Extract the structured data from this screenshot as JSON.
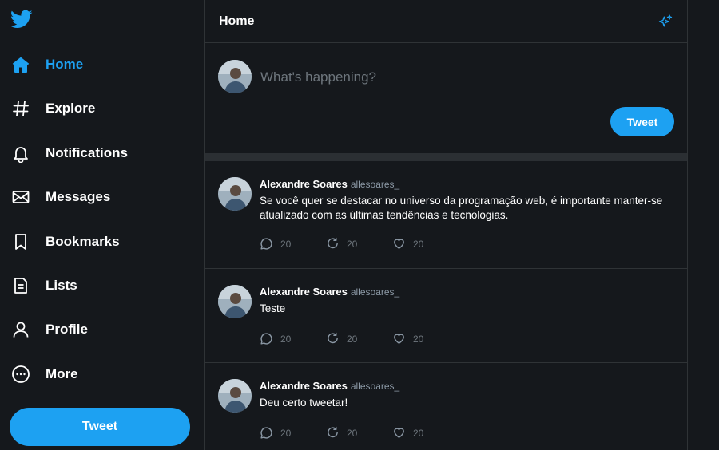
{
  "colors": {
    "accent": "#1da1f2",
    "background": "#15181c",
    "border": "#2f3336",
    "muted": "#6e767d"
  },
  "sidebar": {
    "logo_icon": "twitter-bird-icon",
    "items": [
      {
        "label": "Home",
        "icon": "home-icon",
        "active": true
      },
      {
        "label": "Explore",
        "icon": "hashtag-icon",
        "active": false
      },
      {
        "label": "Notifications",
        "icon": "bell-icon",
        "active": false
      },
      {
        "label": "Messages",
        "icon": "envelope-icon",
        "active": false
      },
      {
        "label": "Bookmarks",
        "icon": "bookmark-icon",
        "active": false
      },
      {
        "label": "Lists",
        "icon": "list-icon",
        "active": false
      },
      {
        "label": "Profile",
        "icon": "user-icon",
        "active": false
      },
      {
        "label": "More",
        "icon": "more-icon",
        "active": false
      }
    ],
    "tweet_button": "Tweet"
  },
  "main": {
    "title": "Home",
    "header_icon": "sparkle-icon",
    "composer": {
      "placeholder": "What's happening?",
      "button": "Tweet"
    },
    "tweets": [
      {
        "name": "Alexandre Soares",
        "handle": "allesoares_",
        "text": "Se você quer se destacar no universo da programação web, é importante manter-se atualizado com as últimas tendências e tecnologias.",
        "replies": "20",
        "retweets": "20",
        "likes": "20"
      },
      {
        "name": "Alexandre Soares",
        "handle": "allesoares_",
        "text": "Teste",
        "replies": "20",
        "retweets": "20",
        "likes": "20"
      },
      {
        "name": "Alexandre Soares",
        "handle": "allesoares_",
        "text": "Deu certo tweetar!",
        "replies": "20",
        "retweets": "20",
        "likes": "20"
      }
    ]
  }
}
